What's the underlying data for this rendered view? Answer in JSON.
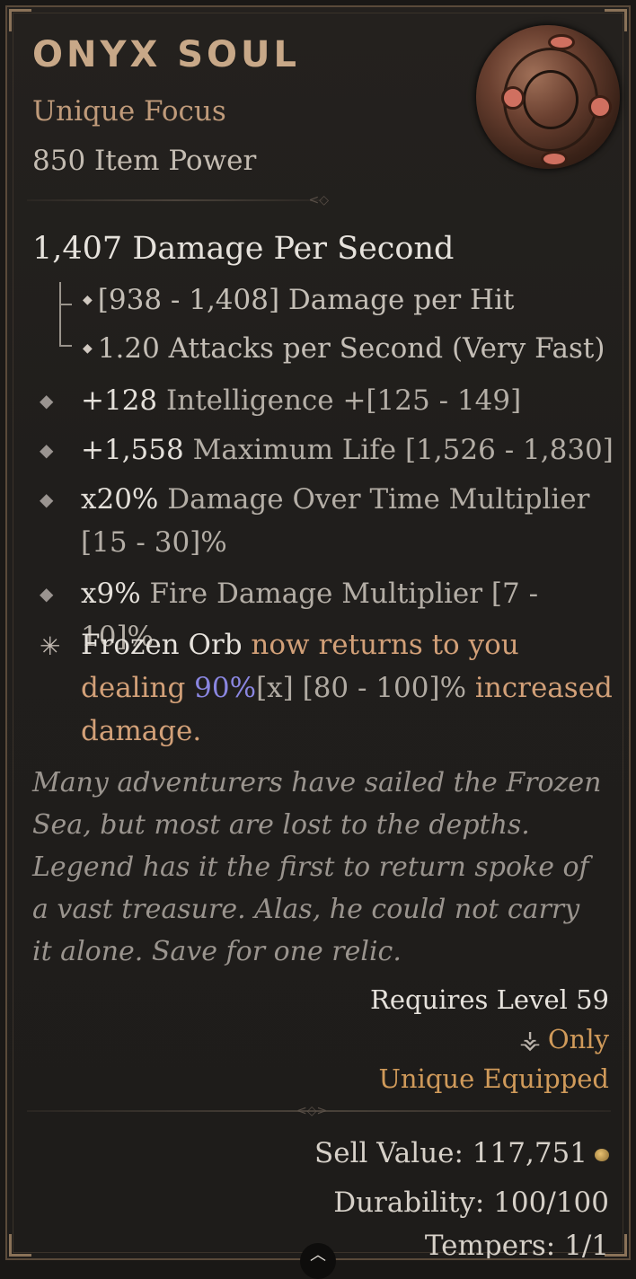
{
  "item": {
    "name": "ONYX SOUL",
    "type": "Unique Focus",
    "power": "850 Item Power",
    "image_icon": "onyx-soul-orb-icon"
  },
  "offense": {
    "dps": "1,407 Damage Per Second",
    "damage_per_hit": "[938 - 1,408] Damage per Hit",
    "attacks_per_second": "1.20 Attacks per Second (Very Fast)"
  },
  "affixes": [
    {
      "value": "+128",
      "text": "Intelligence +[125 - 149]"
    },
    {
      "value": "+1,558",
      "text": "Maximum Life [1,526 - 1,830]"
    },
    {
      "value": "x20%",
      "text": "Damage Over Time Multiplier [15 - 30]%"
    },
    {
      "value": "x9%",
      "text": "Fire Damage Multiplier [7 - 10]%"
    }
  ],
  "unique_power": {
    "skill": "Frozen Orb",
    "text1": " now returns to you dealing ",
    "value": "90%",
    "bracket": "[x]",
    "range": " [80 - 100]%",
    "text2": " increased damage."
  },
  "flavor": "Many adventurers have sailed the Frozen Sea, but most are lost to the depths. Legend has it the first to return spoke of a vast treasure. Alas, he could not carry it alone. Save for one relic.",
  "requirements": {
    "level": "Requires Level 59",
    "class_icon": "sorcerer-class-icon",
    "only": "Only",
    "unique_equipped": "Unique Equipped"
  },
  "footer": {
    "sell_value": "Sell Value: 117,751",
    "durability": "Durability: 100/100",
    "tempers": "Tempers: 1/1",
    "coin_icon": "gold-coin-icon"
  },
  "colors": {
    "title": "#c8a888",
    "unique": "#d09a5a",
    "highlight_blue": "#8a86e0"
  }
}
